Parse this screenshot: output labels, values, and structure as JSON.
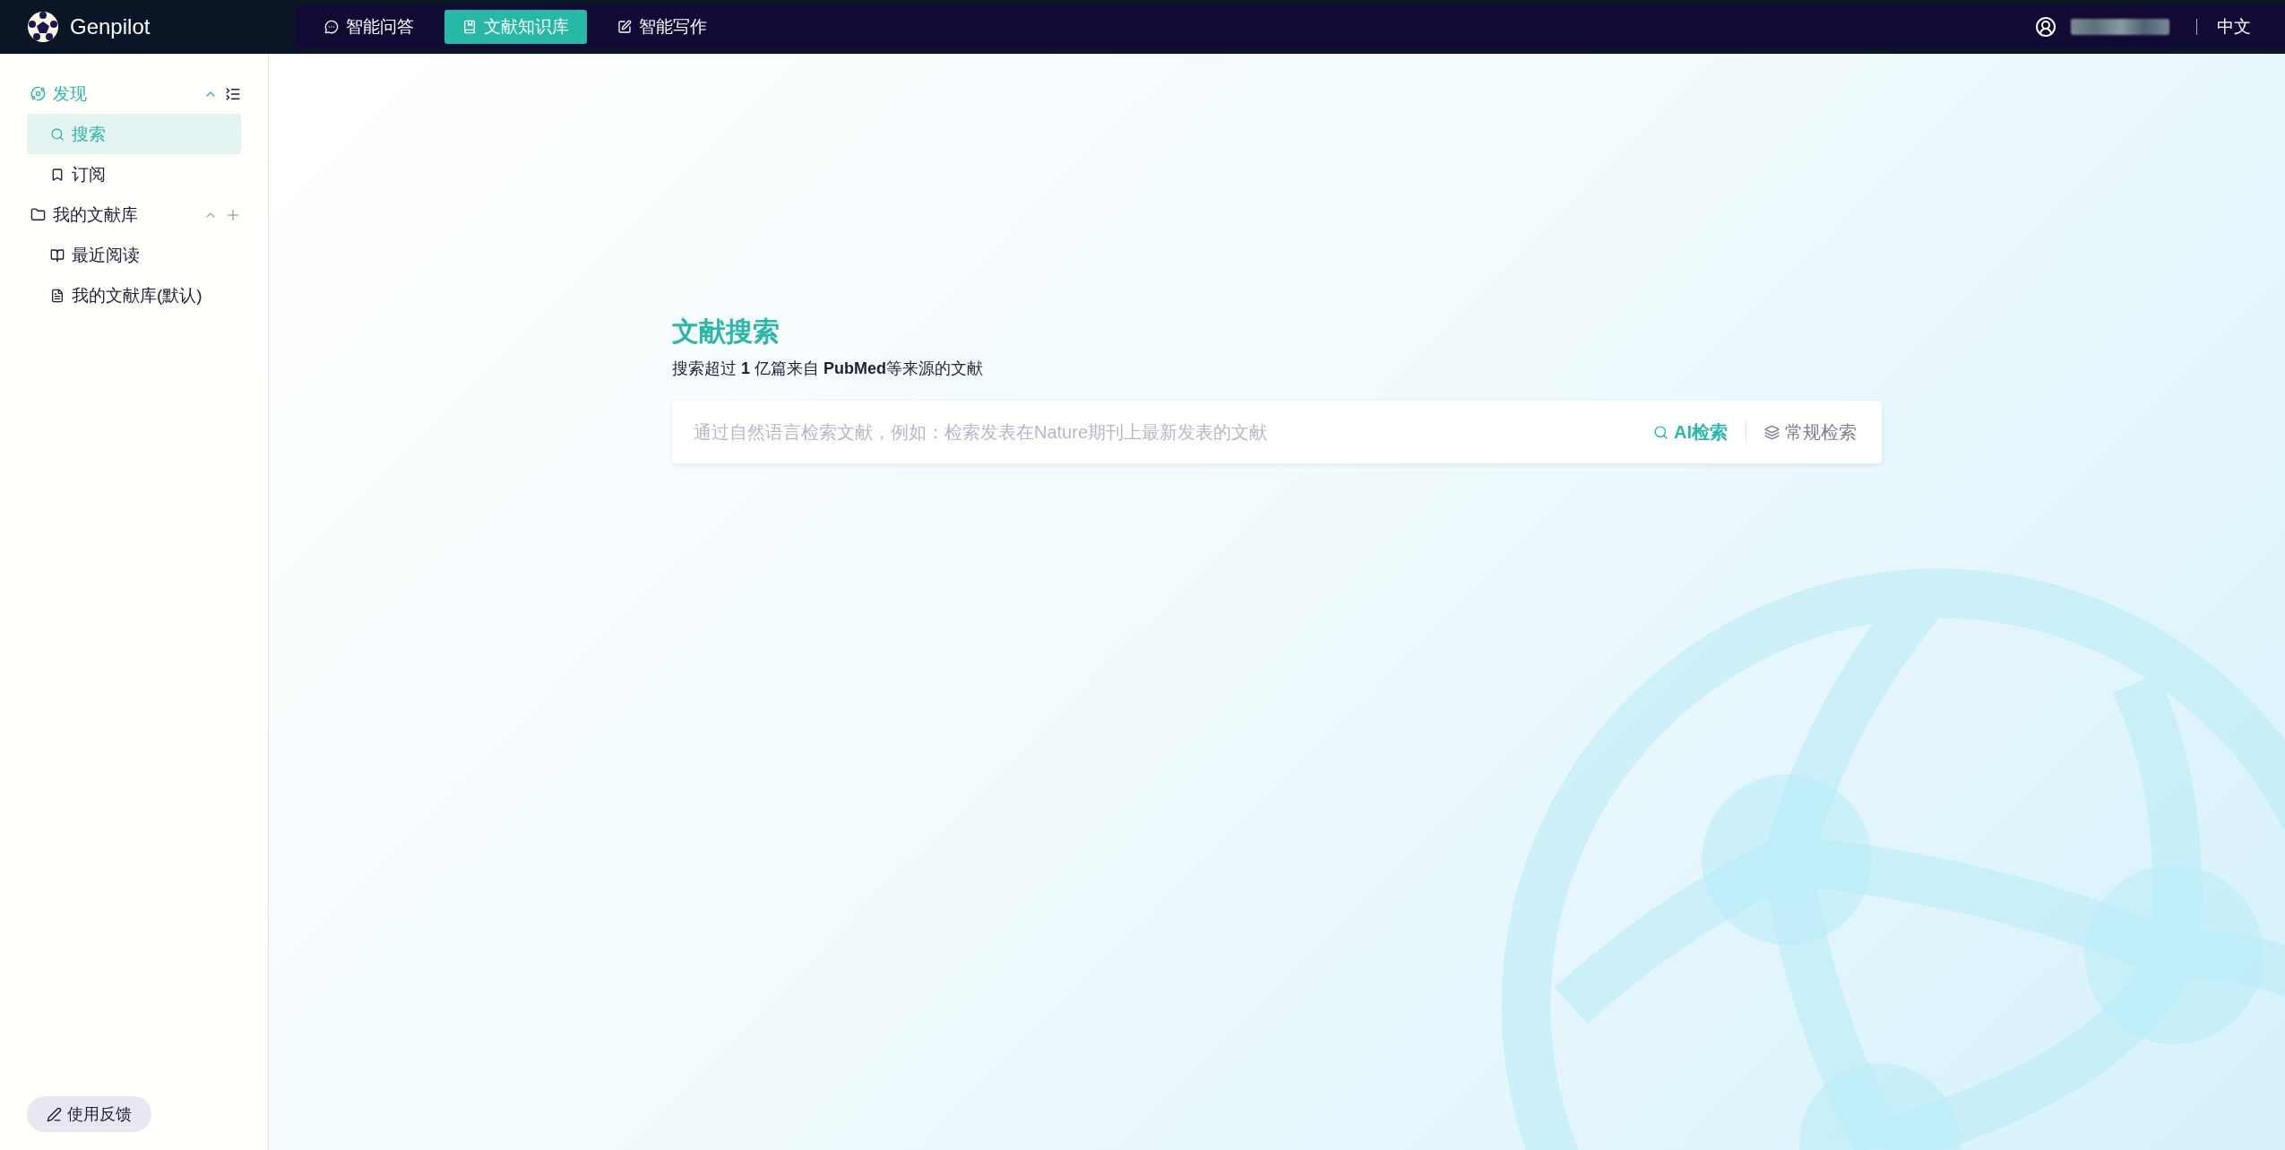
{
  "header": {
    "brand": "Genpilot",
    "tabs": [
      {
        "label": "智能问答",
        "selected": false
      },
      {
        "label": "文献知识库",
        "selected": true
      },
      {
        "label": "智能写作",
        "selected": false
      }
    ],
    "language": "中文"
  },
  "sidebar": {
    "groups": [
      {
        "label": "发现",
        "expanded": true,
        "items": [
          {
            "label": "搜索",
            "selected": true
          },
          {
            "label": "订阅",
            "selected": false
          }
        ]
      },
      {
        "label": "我的文献库",
        "expanded": true,
        "items": [
          {
            "label": "最近阅读",
            "selected": false
          },
          {
            "label": "我的文献库(默认)",
            "selected": false
          }
        ]
      }
    ],
    "feedback": "使用反馈"
  },
  "search": {
    "title": "文献搜索",
    "subtitle": "搜索超过 **1** 亿篇来自 **PubMed**等来源的文献",
    "placeholder": "通过自然语言检索文献，例如：检索发表在Nature期刊上最新发表的文献",
    "modes": [
      {
        "label": "AI检索",
        "selected": true
      },
      {
        "label": "常规检索",
        "selected": false
      }
    ]
  }
}
